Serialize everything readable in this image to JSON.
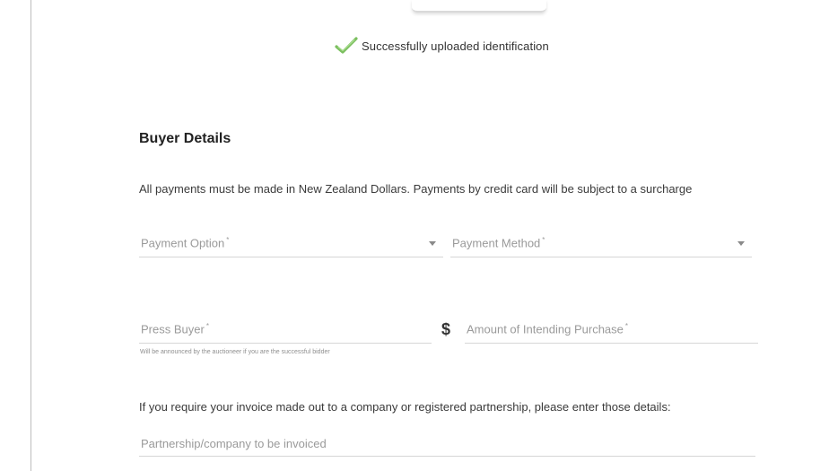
{
  "upload_status": {
    "message": "Successfully uploaded identification",
    "icon": "checkmark-icon",
    "color": "#7bbf5f"
  },
  "buyer_details": {
    "title": "Buyer Details",
    "notice": "All payments must be made in New Zealand Dollars. Payments by credit card will be subject to a surcharge",
    "payment_option": {
      "label": "Payment Option",
      "required_mark": "*",
      "value": ""
    },
    "payment_method": {
      "label": "Payment Method",
      "required_mark": "*",
      "value": ""
    },
    "press_buyer": {
      "label": "Press Buyer",
      "required_mark": "*",
      "hint": "Will be announced by the auctioneer if you are the successful bidder",
      "value": ""
    },
    "currency_symbol": "$",
    "amount": {
      "label": "Amount of Intending Purchase",
      "required_mark": "*",
      "value": ""
    },
    "invoice_note": "If you require your invoice made out to a company or registered partnership, please enter those details:",
    "partnership": {
      "label": "Partnership/company to be invoiced",
      "value": ""
    }
  }
}
